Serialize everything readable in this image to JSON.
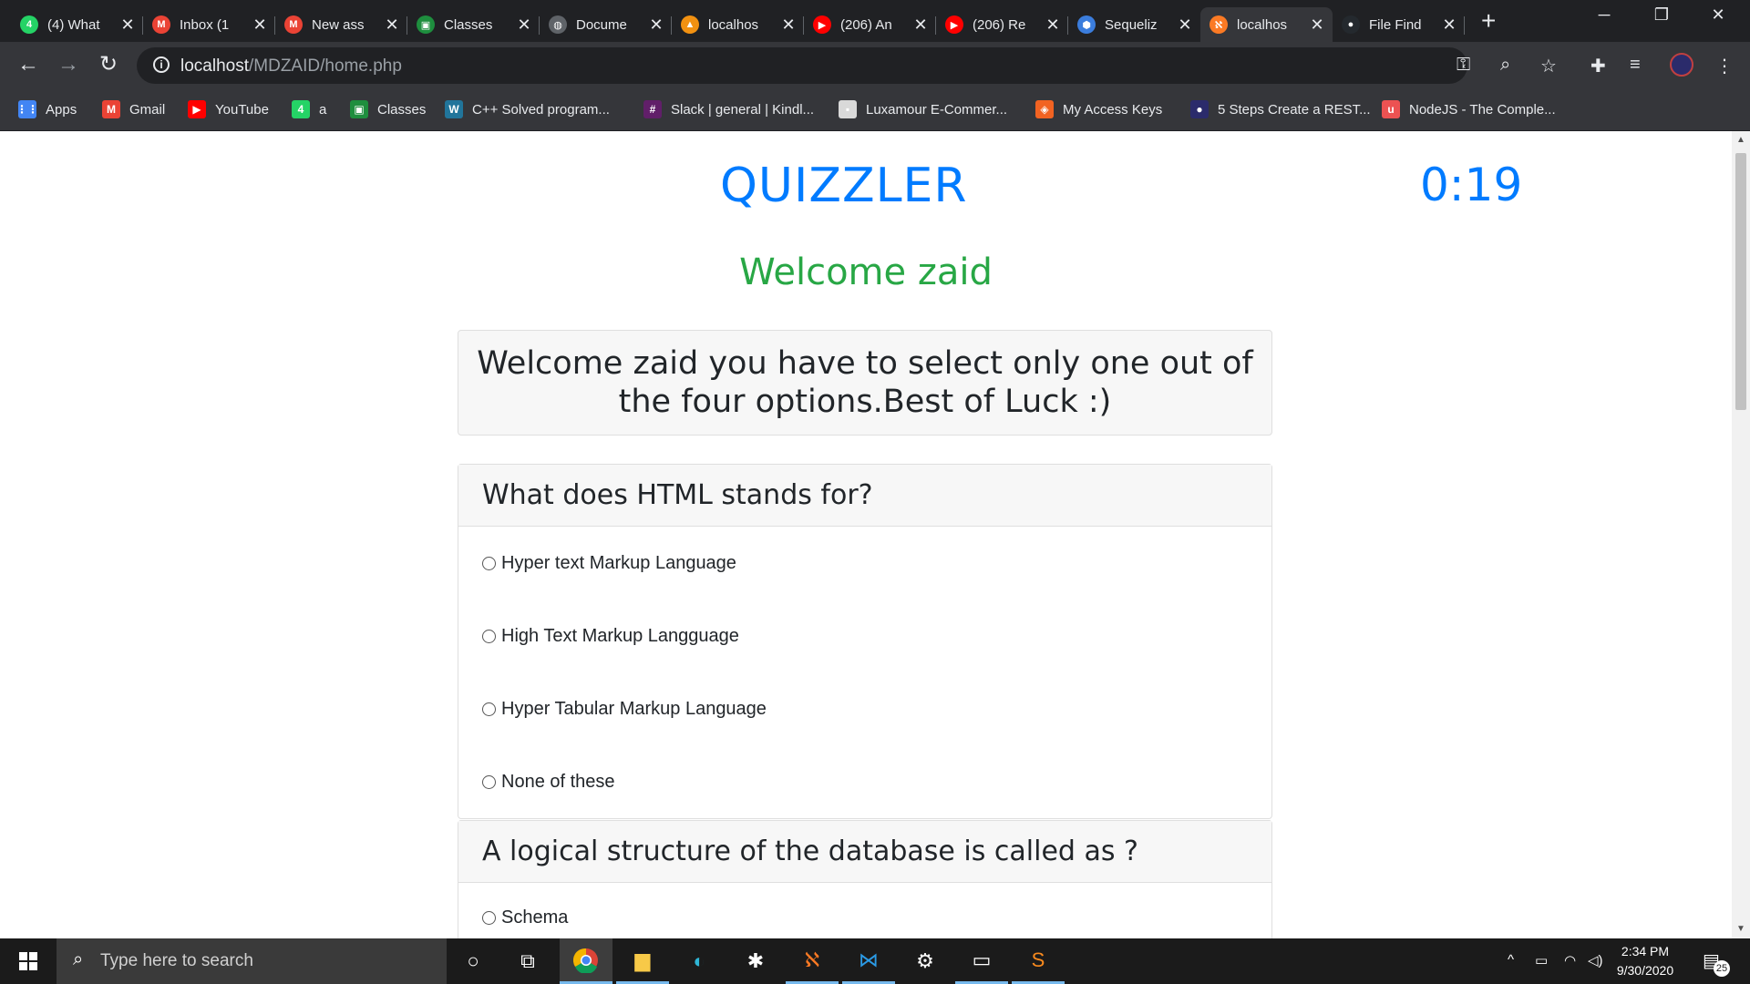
{
  "browser": {
    "tabs": [
      {
        "title": "(4) What",
        "icon": "whatsapp-icon",
        "color": "#25d366",
        "glyph": "4"
      },
      {
        "title": "Inbox (1",
        "icon": "gmail-icon",
        "color": "#ea4335",
        "glyph": "M"
      },
      {
        "title": "New ass",
        "icon": "gmail-icon",
        "color": "#ea4335",
        "glyph": "M"
      },
      {
        "title": "Classes",
        "icon": "classroom-icon",
        "color": "#1e8e3e",
        "glyph": "▣"
      },
      {
        "title": "Docume",
        "icon": "globe-icon",
        "color": "#5f6368",
        "glyph": "◍"
      },
      {
        "title": "localhos",
        "icon": "phpmyadmin-icon",
        "color": "#f29111",
        "glyph": "▲"
      },
      {
        "title": "(206) An",
        "icon": "youtube-icon",
        "color": "#ff0000",
        "glyph": "▶"
      },
      {
        "title": "(206) Re",
        "icon": "youtube-icon",
        "color": "#ff0000",
        "glyph": "▶"
      },
      {
        "title": "Sequeliz",
        "icon": "sequelize-icon",
        "color": "#3b7ddd",
        "glyph": "⬢"
      },
      {
        "title": "localhos",
        "icon": "xampp-icon",
        "color": "#fb7a24",
        "glyph": "ℵ"
      },
      {
        "title": "File Find",
        "icon": "github-icon",
        "color": "#24292e",
        "glyph": "●"
      }
    ],
    "active_tab_index": 9,
    "url_host": "localhost",
    "url_path": "/MDZAID/home.php",
    "bookmarks": [
      {
        "label": "Apps",
        "icon": "apps-grid-icon",
        "color": "#4285f4",
        "glyph": "⋮⋮"
      },
      {
        "label": "Gmail",
        "icon": "gmail-icon",
        "color": "#ea4335",
        "glyph": "M"
      },
      {
        "label": "YouTube",
        "icon": "youtube-icon",
        "color": "#ff0000",
        "glyph": "▶"
      },
      {
        "label": "a",
        "icon": "whatsapp-icon",
        "color": "#25d366",
        "glyph": "4"
      },
      {
        "label": "Classes",
        "icon": "classroom-icon",
        "color": "#1e8e3e",
        "glyph": "▣"
      },
      {
        "label": "C++ Solved program...",
        "icon": "wordpress-icon",
        "color": "#21759b",
        "glyph": "W"
      },
      {
        "label": "Slack | general | Kindl...",
        "icon": "slack-icon",
        "color": "#611f69",
        "glyph": "#"
      },
      {
        "label": "Luxamour E-Commer...",
        "icon": "bookmark-page-icon",
        "color": "#d9d9d9",
        "glyph": "▪"
      },
      {
        "label": "My Access Keys",
        "icon": "magento-icon",
        "color": "#f26322",
        "glyph": "◈"
      },
      {
        "label": "5 Steps Create a REST...",
        "icon": "avatar-icon",
        "color": "#2b2b6b",
        "glyph": "●"
      },
      {
        "label": "NodeJS - The Comple...",
        "icon": "udemy-icon",
        "color": "#ec5252",
        "glyph": "u"
      }
    ]
  },
  "page": {
    "brand": "QUIZZLER",
    "timer": "0:19",
    "welcome": "Welcome zaid",
    "intro": "Welcome zaid you have to select only one out of the four options.Best of Luck :)",
    "questions": [
      {
        "text": "What does HTML stands for?",
        "options": [
          "Hyper text Markup Language",
          "High Text Markup Langguage",
          "Hyper Tabular Markup Language",
          "None of these"
        ]
      },
      {
        "text": "A logical structure of the database is called as ?",
        "options": [
          "Schema"
        ]
      }
    ]
  },
  "taskbar": {
    "search_placeholder": "Type here to search",
    "time": "2:34 PM",
    "date": "9/30/2020",
    "notification_count": "25"
  }
}
